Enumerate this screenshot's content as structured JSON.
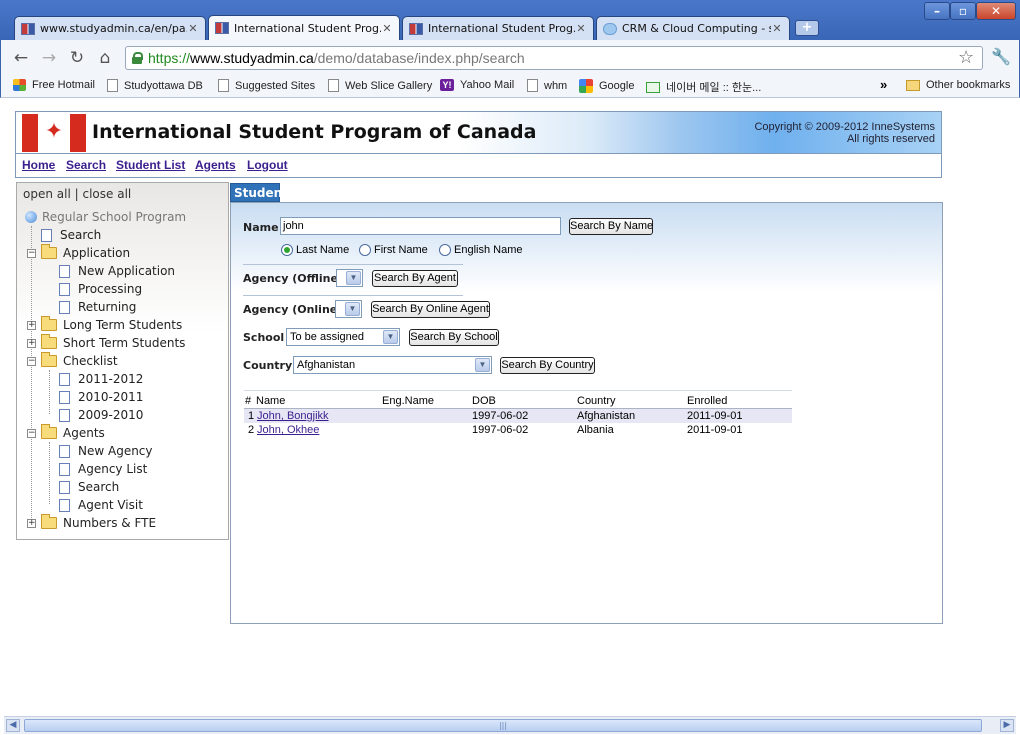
{
  "browser": {
    "tabs": [
      {
        "title": "www.studyadmin.ca/en/pa...",
        "active": false
      },
      {
        "title": "International Student Prog...",
        "active": true
      },
      {
        "title": "International Student Prog...",
        "active": false
      },
      {
        "title": "CRM & Cloud Computing - s...",
        "active": false
      }
    ],
    "new_tab": "+",
    "window_controls": {
      "minimize": "–",
      "maximize": "▫",
      "close": "✕"
    },
    "nav": {
      "back": "←",
      "forward": "→",
      "reload": "↻",
      "home": "⌂"
    },
    "url": {
      "scheme": "https://",
      "host": "www.studyadmin.ca",
      "path": "/demo/database/index.php/search"
    },
    "bookmarks": [
      {
        "label": "Free Hotmail",
        "icon": "hotmail"
      },
      {
        "label": "Studyottawa DB",
        "icon": "page"
      },
      {
        "label": "Suggested Sites",
        "icon": "page"
      },
      {
        "label": "Web Slice Gallery",
        "icon": "page"
      },
      {
        "label": "Yahoo Mail",
        "icon": "yahoo"
      },
      {
        "label": "whm",
        "icon": "page"
      },
      {
        "label": "Google",
        "icon": "google"
      },
      {
        "label": "네이버 메일 :: 한눈...",
        "icon": "mail"
      }
    ],
    "bookmarks_more": "»",
    "other_bookmarks": "Other bookmarks",
    "yahoo_glyph": "Y!"
  },
  "site": {
    "title": "International Student Program of Canada",
    "copyright_line1": "Copyright © 2009-2012 InneSystems",
    "copyright_line2": "All rights reserved",
    "nav": [
      "Home",
      "Search",
      "Student List",
      "Agents",
      "Logout"
    ]
  },
  "sidebar": {
    "open_all": "open all",
    "separator": "|",
    "close_all": "close all",
    "root": "Regular School Program",
    "items": {
      "search": "Search",
      "application": "Application",
      "new_application": "New Application",
      "processing": "Processing",
      "returning": "Returning",
      "long_term": "Long Term Students",
      "short_term": "Short Term Students",
      "checklist": "Checklist",
      "y2011": "2011-2012",
      "y2010": "2010-2011",
      "y2009": "2009-2010",
      "agents": "Agents",
      "new_agency": "New Agency",
      "agency_list": "Agency List",
      "agent_search": "Search",
      "agent_visit": "Agent Visit",
      "numbers_fte": "Numbers & FTE"
    },
    "plus": "+",
    "minus": "−"
  },
  "panel": {
    "tab": "Student",
    "name_label": "Name",
    "name_value": "john",
    "search_by_name": "Search By Name",
    "radio_last": "Last Name",
    "radio_first": "First Name",
    "radio_english": "English Name",
    "agency_offline_label": "Agency (Offline)",
    "search_by_agent": "Search By Agent",
    "agency_online_label": "Agency (Online)",
    "search_by_online_agent": "Search By Online Agent",
    "school_label": "School",
    "school_value": "To be assigned",
    "search_by_school": "Search By School",
    "country_label": "Country",
    "country_value": "Afghanistan",
    "search_by_country": "Search By Country",
    "dropdown_glyph": "▼"
  },
  "results": {
    "headers": {
      "num": "#",
      "name": "Name",
      "eng": "Eng.Name",
      "dob": "DOB",
      "country": "Country",
      "enrolled": "Enrolled"
    },
    "rows": [
      {
        "num": "1",
        "name": "John, Bongjikk",
        "eng": "",
        "dob": "1997-06-02",
        "country": "Afghanistan",
        "enrolled": "2011-09-01"
      },
      {
        "num": "2",
        "name": "John, Okhee",
        "eng": "",
        "dob": "1997-06-02",
        "country": "Albania",
        "enrolled": "2011-09-01"
      }
    ]
  },
  "colors": {
    "accent": "#2f72b8",
    "link": "#3b1f8e",
    "flag_red": "#d52b1e"
  }
}
